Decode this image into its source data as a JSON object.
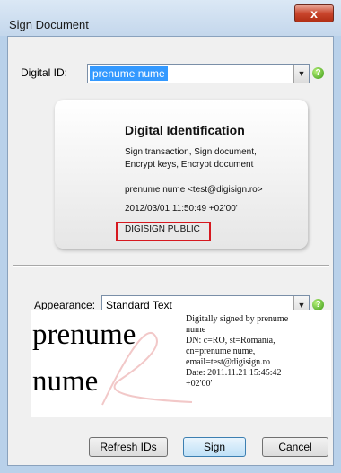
{
  "window": {
    "title": "Sign Document",
    "close_glyph": "x"
  },
  "digital_id": {
    "label": "Digital ID:",
    "value": "prenume nume",
    "help_glyph": "?"
  },
  "card": {
    "heading": "Digital Identification",
    "capabilities_line1": "Sign transaction, Sign document,",
    "capabilities_line2": "Encrypt keys, Encrypt document",
    "owner": "prenume nume <test@digisign.ro>",
    "date": "2012/03/01 11:50:49 +02'00'",
    "issuer": "DIGISIGN PUBLIC"
  },
  "appearance": {
    "label": "Appearance:",
    "value": "Standard Text",
    "help_glyph": "?"
  },
  "preview": {
    "name_line1": "prenume",
    "name_line2": "nume",
    "details": [
      "Digitally signed by prenume",
      "nume",
      "DN: c=RO, st=Romania,",
      "cn=prenume nume,",
      "email=test@digisign.ro",
      "Date: 2011.11.21 15:45:42",
      "+02'00'"
    ]
  },
  "buttons": {
    "refresh": "Refresh IDs",
    "sign": "Sign",
    "cancel": "Cancel"
  },
  "colors": {
    "highlight_border": "#d6181f",
    "selection_blue": "#3399ff",
    "help_green": "#3a9a14"
  },
  "icons": {
    "close": "close-icon",
    "help": "help-icon",
    "dropdown": "chevron-down-icon",
    "watermark": "adobe-watermark-icon"
  }
}
